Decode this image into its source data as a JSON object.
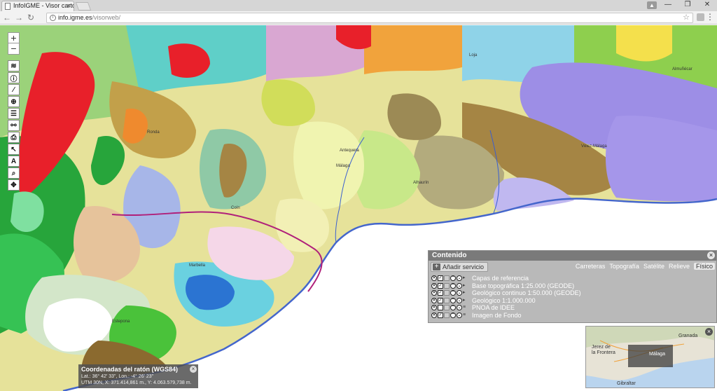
{
  "browser": {
    "tab_title": "InfoIGME - Visor cartogr",
    "tab_close": "×",
    "url_host": "info.igme.es",
    "url_path": "/visorweb/",
    "window_buttons": [
      "—",
      "❐",
      "✕"
    ]
  },
  "map": {
    "zoom_in": "+",
    "zoom_out": "−",
    "tools": [
      "layers-icon",
      "info-icon",
      "measure-icon",
      "locate-icon",
      "legend-icon",
      "share-icon",
      "print-icon",
      "select-icon",
      "text-icon",
      "search-icon",
      "extent-icon"
    ],
    "place_labels": [
      "Málaga",
      "Antequera",
      "Marbella",
      "Almuñécar",
      "Alhaurín",
      "Coín",
      "Ronda",
      "Estepona",
      "Vélez-Málaga",
      "Loja"
    ],
    "colors": {
      "sea": "#ffffff",
      "coast": "#4466cc",
      "boundary": "#b0207a"
    }
  },
  "contents_panel": {
    "title": "Contenido",
    "close": "×",
    "add_service": "Añadir servicio",
    "basemaps": [
      {
        "label": "Carreteras",
        "active": false
      },
      {
        "label": "Topografía",
        "active": false
      },
      {
        "label": "Satélite",
        "active": false
      },
      {
        "label": "Relieve",
        "active": false
      },
      {
        "label": "Físico",
        "active": true
      }
    ],
    "layers": [
      {
        "name": "Capas de referencia",
        "checked": true
      },
      {
        "name": "Base topográfica 1:25.000 (GEODE)",
        "checked": true
      },
      {
        "name": "Geológico continuo 1:50.000 (GEODE)",
        "checked": true
      },
      {
        "name": "Geológico 1:1.000.000",
        "checked": true
      },
      {
        "name": "PNOA de IDEE",
        "checked": false
      },
      {
        "name": "Imagen de Fondo",
        "checked": true
      }
    ]
  },
  "overview": {
    "labels": [
      "Granada",
      "Jerez de la Frontera",
      "Málaga",
      "Gibraltar"
    ],
    "close": "×"
  },
  "coordinates": {
    "title": "Coordenadas del ratón (WGS84)",
    "latlon": "Lat.: 36° 42' 33\", Lon.: -4° 26' 23\"",
    "utm": "UTM 30N, X: 371.414,861 m., Y: 4.063.579,738 m."
  }
}
